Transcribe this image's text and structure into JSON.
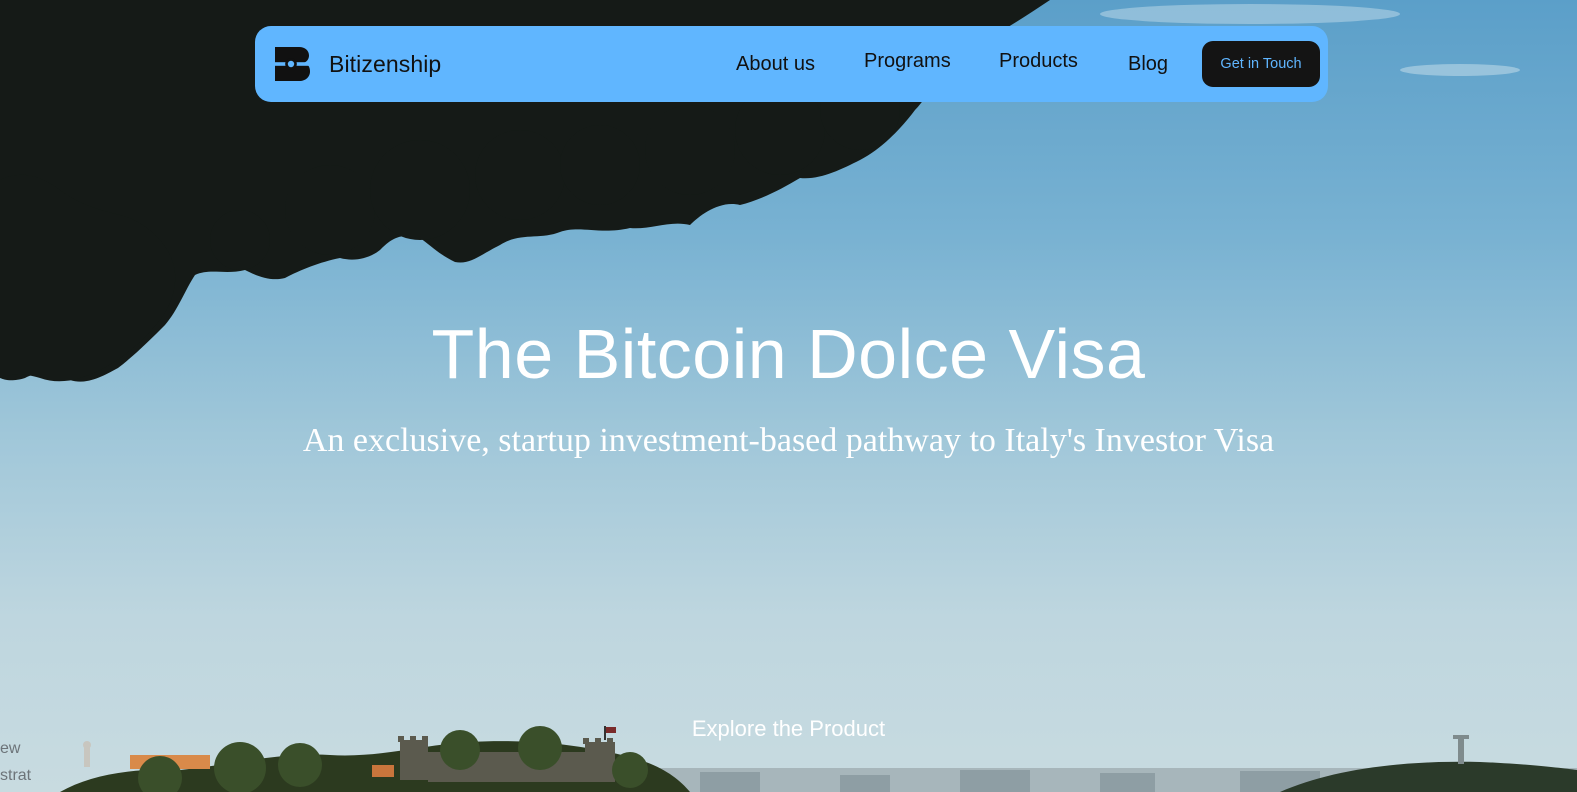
{
  "brand": {
    "name": "Bitizenship",
    "logo_icon": "bitizenship-b-logo-icon"
  },
  "nav": {
    "items": [
      {
        "label": "About us"
      },
      {
        "label": "Programs"
      },
      {
        "label": "Products"
      },
      {
        "label": "Blog"
      }
    ],
    "cta_label": "Get in Touch"
  },
  "hero": {
    "title": "The Bitcoin Dolce Visa",
    "subtitle": "An exclusive, startup investment-based pathway to Italy's Investor Visa",
    "explore_label": "Explore the Product"
  },
  "edge_text": {
    "line1": "ew",
    "line2": "strat"
  },
  "colors": {
    "navbar_bg": "#60b6ff",
    "cta_bg": "#141414",
    "cta_text": "#60b6ff",
    "hero_text": "#ffffff"
  }
}
